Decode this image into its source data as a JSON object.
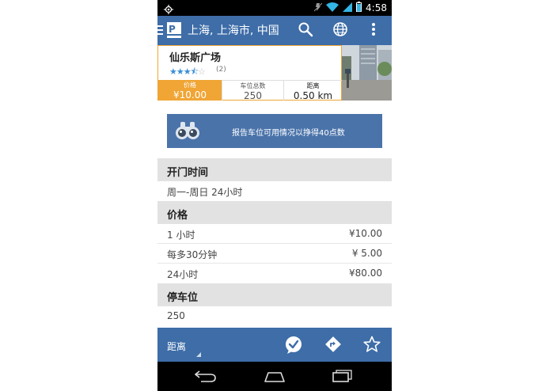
{
  "status_bar": {
    "time": "4:58"
  },
  "action_bar": {
    "title": "上海, 上海市, 中国"
  },
  "parking": {
    "name": "仙乐斯广场",
    "rating": 3.5,
    "rating_count": "(2)",
    "stats": {
      "price_label": "价格",
      "price_value": "¥10.00",
      "total_label": "车位总数",
      "total_value": "250",
      "distance_label": "距离",
      "distance_value": "0.50 km"
    }
  },
  "banner": {
    "text": "报告车位可用情况以挣得40点数"
  },
  "sections": {
    "hours": {
      "title": "开门时间",
      "value": "周一-周日 24小时"
    },
    "price": {
      "title": "价格",
      "rows": [
        {
          "label": "1 小时",
          "value": "¥10.00"
        },
        {
          "label": "每多30分钟",
          "value": "¥ 5.00"
        },
        {
          "label": "24小时",
          "value": "¥80.00"
        }
      ]
    },
    "spaces": {
      "title": "停车位",
      "value": "250"
    }
  },
  "bottom_bar": {
    "sort_label": "距离"
  },
  "colors": {
    "primary": "#3e6da8",
    "accent": "#f0a535",
    "star": "#3a8ed6",
    "section_bg": "#e2e2e2"
  }
}
